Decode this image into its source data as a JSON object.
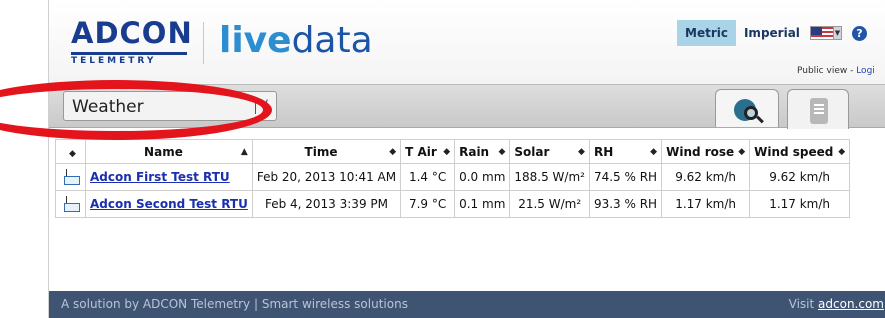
{
  "header": {
    "brand": "ADCON",
    "brand_sub": "TELEMETRY",
    "product_live": "live",
    "product_data": "data",
    "units": {
      "metric": "Metric",
      "imperial": "Imperial"
    },
    "help": "?",
    "public_view": "Public view - ",
    "login": "Logi"
  },
  "toolbar": {
    "selected_view": "Weather",
    "tabs": [
      "search-map-tab",
      "list-tab"
    ]
  },
  "table": {
    "columns": [
      "",
      "Name",
      "Time",
      "T Air",
      "Rain",
      "Solar",
      "RH",
      "Wind rose",
      "Wind speed"
    ],
    "rows": [
      {
        "name": "Adcon First Test RTU",
        "time": "Feb 20, 2013 10:41 AM",
        "t_air": "1.4 °C",
        "rain": "0.0 mm",
        "solar": "188.5 W/m²",
        "rh": "74.5 % RH",
        "wind_rose": "9.62 km/h",
        "wind_speed": "9.62 km/h"
      },
      {
        "name": "Adcon Second Test RTU",
        "time": "Feb 4, 2013 3:39 PM",
        "t_air": "7.9 °C",
        "rain": "0.1 mm",
        "solar": "21.5 W/m²",
        "rh": "93.3 % RH",
        "wind_rose": "1.17 km/h",
        "wind_speed": "1.17 km/h"
      }
    ]
  },
  "footer": {
    "left": "A solution by ADCON Telemetry | Smart wireless solutions",
    "right_prefix": "Visit ",
    "right_link": "adcon.com"
  },
  "colors": {
    "accent": "#1a3c8f",
    "highlight": "#e3141c",
    "footer_bg": "#3f5472"
  }
}
